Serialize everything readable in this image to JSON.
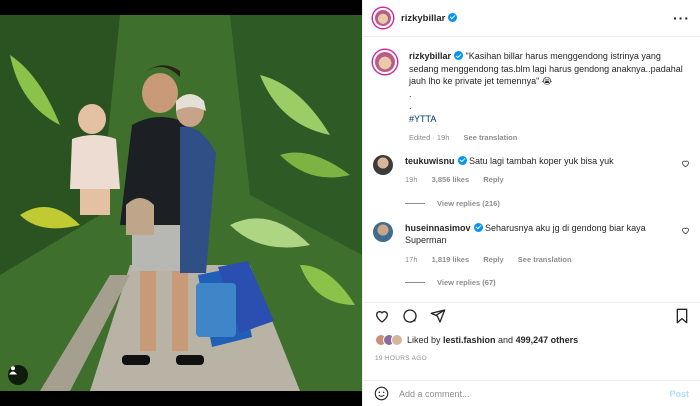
{
  "post": {
    "username": "rizkybillar",
    "caption": {
      "text": "\"Kasihan billar harus menggendong istrinya yang sedang menggendong tas.blm lagi harus gendong anaknya..padahal jauh lho ke private jet temennya\" 😭",
      "dots": [
        "."
      ],
      "hashtag": "#YTTA"
    },
    "edited": "Edited · 19h",
    "see_translation": "See translation"
  },
  "comments": [
    {
      "username": "teukuwisnu",
      "text": "Satu lagi tambah koper yuk bisa yuk",
      "time": "19h",
      "likes": "3,856 likes",
      "reply": "Reply",
      "view_replies": "View replies (216)"
    },
    {
      "username": "huseinnasimov",
      "text": "Seharusnya aku jg di gendong biar kaya Superman",
      "time": "17h",
      "likes": "1,819 likes",
      "reply": "Reply",
      "see_translation": "See translation",
      "view_replies": "View replies (67)"
    }
  ],
  "likes": {
    "prefix": "Liked by ",
    "user": "lesti.fashion",
    "middle": " and ",
    "count": "499,247 others"
  },
  "timestamp": "19 HOURS AGO",
  "add_comment": {
    "placeholder": "Add a comment...",
    "post_label": "Post"
  },
  "icons": {
    "more": "more-icon",
    "heart": "heart-icon",
    "comment": "comment-icon",
    "share": "share-icon",
    "save": "bookmark-icon",
    "emoji": "emoji-icon",
    "user_tag": "user-tag-icon"
  },
  "colors": {
    "verified": "#0095f6",
    "post_disabled": "#b2dffc",
    "hashtag": "#00376b"
  }
}
